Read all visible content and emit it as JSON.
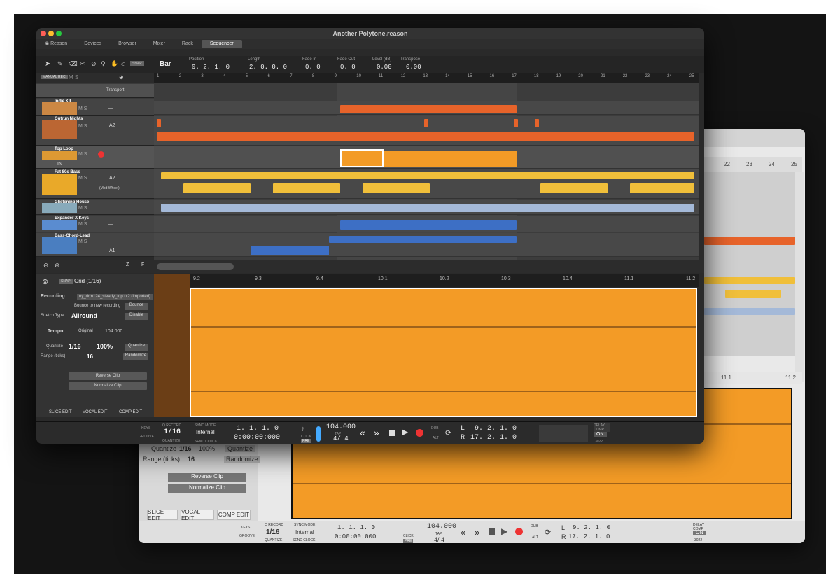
{
  "window": {
    "title": "Another Polytone.reason"
  },
  "nav": {
    "reason": "Reason",
    "devices": "Devices",
    "browser": "Browser",
    "mixer": "Mixer",
    "rack": "Rack",
    "sequencer": "Sequencer"
  },
  "toolbar": {
    "snap": "SNAP",
    "bar": "Bar",
    "position_label": "Position",
    "position": "9. 2. 1. 0",
    "length_label": "Length",
    "length": "2. 0. 0. 0",
    "fadein_label": "Fade In",
    "fadein": "0. 0",
    "fadeout_label": "Fade Out",
    "fadeout": "0. 0",
    "level_label": "Level (dB)",
    "level": "0.00",
    "transpose_label": "Transpose",
    "transpose": "0.00"
  },
  "track_area": {
    "manual_rec": "MANUAL REC",
    "ms": "M S",
    "transport": "Transport"
  },
  "tracks": [
    {
      "name": "Indie Kit",
      "lane": "—"
    },
    {
      "name": "Outrun Nights",
      "lane": "A2"
    },
    {
      "name": "Top Loop",
      "lane": "IN"
    },
    {
      "name": "Fat 80s Bass",
      "lane": "A2",
      "sublane": "(Mod Wheel)"
    },
    {
      "name": "Glistening House",
      "lane": ""
    },
    {
      "name": "Expander X Keys",
      "lane": "—"
    },
    {
      "name": "Bass-Chord-Lead",
      "lane": "A1"
    }
  ],
  "ruler": [
    "1",
    "2",
    "3",
    "4",
    "5",
    "6",
    "7",
    "8",
    "9",
    "10",
    "11",
    "12",
    "13",
    "14",
    "15",
    "16",
    "17",
    "18",
    "19",
    "20",
    "21",
    "22",
    "23",
    "24",
    "25"
  ],
  "zoom_toolbar": {
    "zoom": "Z",
    "f": "F"
  },
  "editor": {
    "snap": "SNAP",
    "grid": "Grid (1/16)",
    "recording_label": "Recording",
    "recording_file": "ny_drm124_steady_top.rx2 (Imported)",
    "bounce_label": "Bounce to new recording",
    "bounce": "Bounce",
    "stretch_label": "Stretch Type",
    "stretch": "Allround",
    "disable": "Disable",
    "tempo_label": "Tempo",
    "original_label": "Original",
    "tempo": "104.000",
    "quantize_label": "Quantize",
    "quantize": "1/16",
    "quantize_pct": "100%",
    "quantize_btn": "Quantize",
    "range_label": "Range (ticks)",
    "range": "16",
    "randomize": "Randomize",
    "reverse": "Reverse Clip",
    "normalize": "Normalize Clip",
    "tabs": [
      "SLICE EDIT",
      "VOCAL EDIT",
      "COMP EDIT"
    ],
    "ruler": [
      "9.2",
      "9.3",
      "9.4",
      "10.1",
      "10.2",
      "10.3",
      "10.4",
      "11.1",
      "11.2"
    ]
  },
  "transport": {
    "keys": "KEYS",
    "groove": "GROOVE",
    "qrecord_label": "Q RECORD",
    "qrecord": "1/16",
    "quantize_label": "QUANTIZE",
    "sync_label": "SYNC MODE",
    "sync": "Internal",
    "send_clock": "SEND CLOCK",
    "position": "1. 1. 1. 0",
    "time": "0:00:00:000",
    "click": "CLICK",
    "pre": "PRE",
    "tempo": "104.000",
    "tap": "TAP",
    "signature": "4/ 4",
    "dub": "DUB",
    "alt": "ALT",
    "loop_l_label": "L",
    "loop_l": "9. 2. 1. 0",
    "loop_r_label": "R",
    "loop_r": "17. 2. 1. 0",
    "delay_comp": "DELAY COMP",
    "on": "ON",
    "delay_value": "3022"
  },
  "back_window": {
    "ruler": [
      "22",
      "23",
      "24",
      "25"
    ],
    "editor_ruler": [
      "11.1",
      "11.2"
    ],
    "quantize_label": "Quantize",
    "quantize": "1/16",
    "quantize_pct": "100%",
    "quantize_btn": "Quantize",
    "range_label": "Range (ticks)",
    "range": "16",
    "randomize": "Randomize",
    "reverse": "Reverse Clip",
    "normalize": "Normalize Clip",
    "tabs": [
      "SLICE EDIT",
      "VOCAL EDIT",
      "COMP EDIT"
    ],
    "transport": {
      "keys": "KEYS",
      "groove": "GROOVE",
      "qrecord_label": "Q RECORD",
      "qrecord": "1/16",
      "quantize_label": "QUANTIZE",
      "sync_label": "SYNC MODE",
      "sync": "Internal",
      "send_clock": "SEND CLOCK",
      "position": "1. 1. 1. 0",
      "time": "0:00:00:000",
      "click": "CLICK",
      "pre": "PRE",
      "tempo": "104.000",
      "tap": "TAP",
      "signature": "4/ 4",
      "dub": "DUB",
      "alt": "ALT",
      "loop_l_label": "L",
      "loop_l": "9. 2. 1. 0",
      "loop_r_label": "R",
      "loop_r": "17. 2. 1. 0",
      "delay_comp": "DELAY COMP",
      "on": "ON",
      "delay_value": "3022"
    }
  }
}
